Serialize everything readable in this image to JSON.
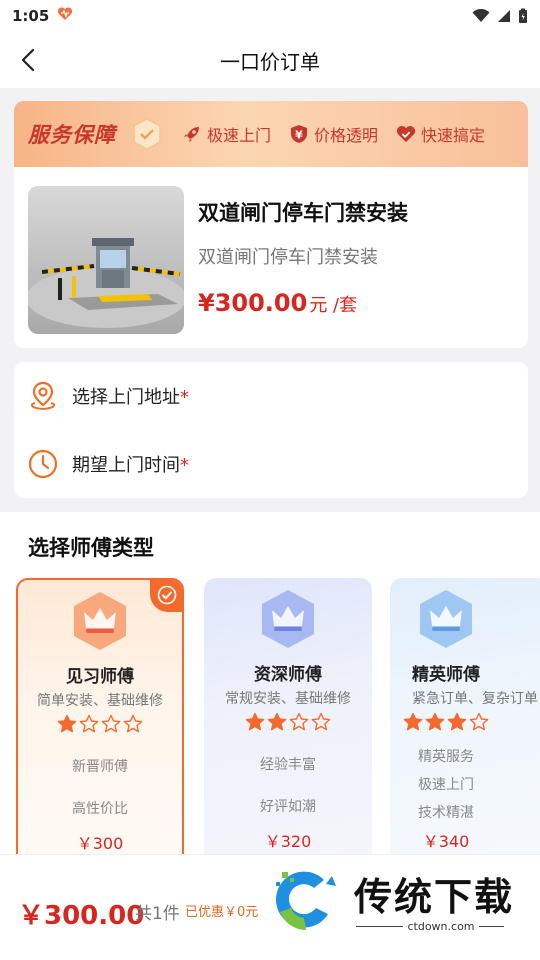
{
  "status_bar": {
    "time": "1:05"
  },
  "nav": {
    "title": "一口价订单"
  },
  "service_banner": {
    "title": "服务保障",
    "features": [
      "极速上门",
      "价格透明",
      "快速搞定"
    ]
  },
  "product": {
    "name": "双道闸门停车门禁安装",
    "subtitle": "双道闸门停车门禁安装",
    "price": "¥300.00",
    "unit": "元 /套"
  },
  "address": {
    "address_label": "选择上门地址",
    "time_label": "期望上门时间",
    "required_mark": "*"
  },
  "master_types": {
    "title": "选择师傅类型",
    "cards": [
      {
        "name": "见习师傅",
        "desc": "简单安装、基础维修",
        "stars": 1,
        "features": [
          "新晋师傅",
          "高性价比"
        ],
        "price": "￥300",
        "selected": true
      },
      {
        "name": "资深师傅",
        "desc": "常规安装、基础维修",
        "stars": 2,
        "features": [
          "经验丰富",
          "好评如潮"
        ],
        "price": "￥320",
        "selected": false
      },
      {
        "name": "精英师傅",
        "desc": "紧急订单、复杂订单",
        "stars": 3,
        "features": [
          "精英服务",
          "极速上门",
          "技术精湛"
        ],
        "price": "￥340",
        "selected": false
      }
    ]
  },
  "bottom": {
    "total": "￥300.00",
    "count": "共1件",
    "discount": "已优惠￥0元"
  },
  "watermark": {
    "brand": "传统下载",
    "url": "ctdown.com"
  },
  "colors": {
    "accent": "#f36b2c",
    "price": "#d7261e",
    "banner_text": "#c8382a"
  }
}
